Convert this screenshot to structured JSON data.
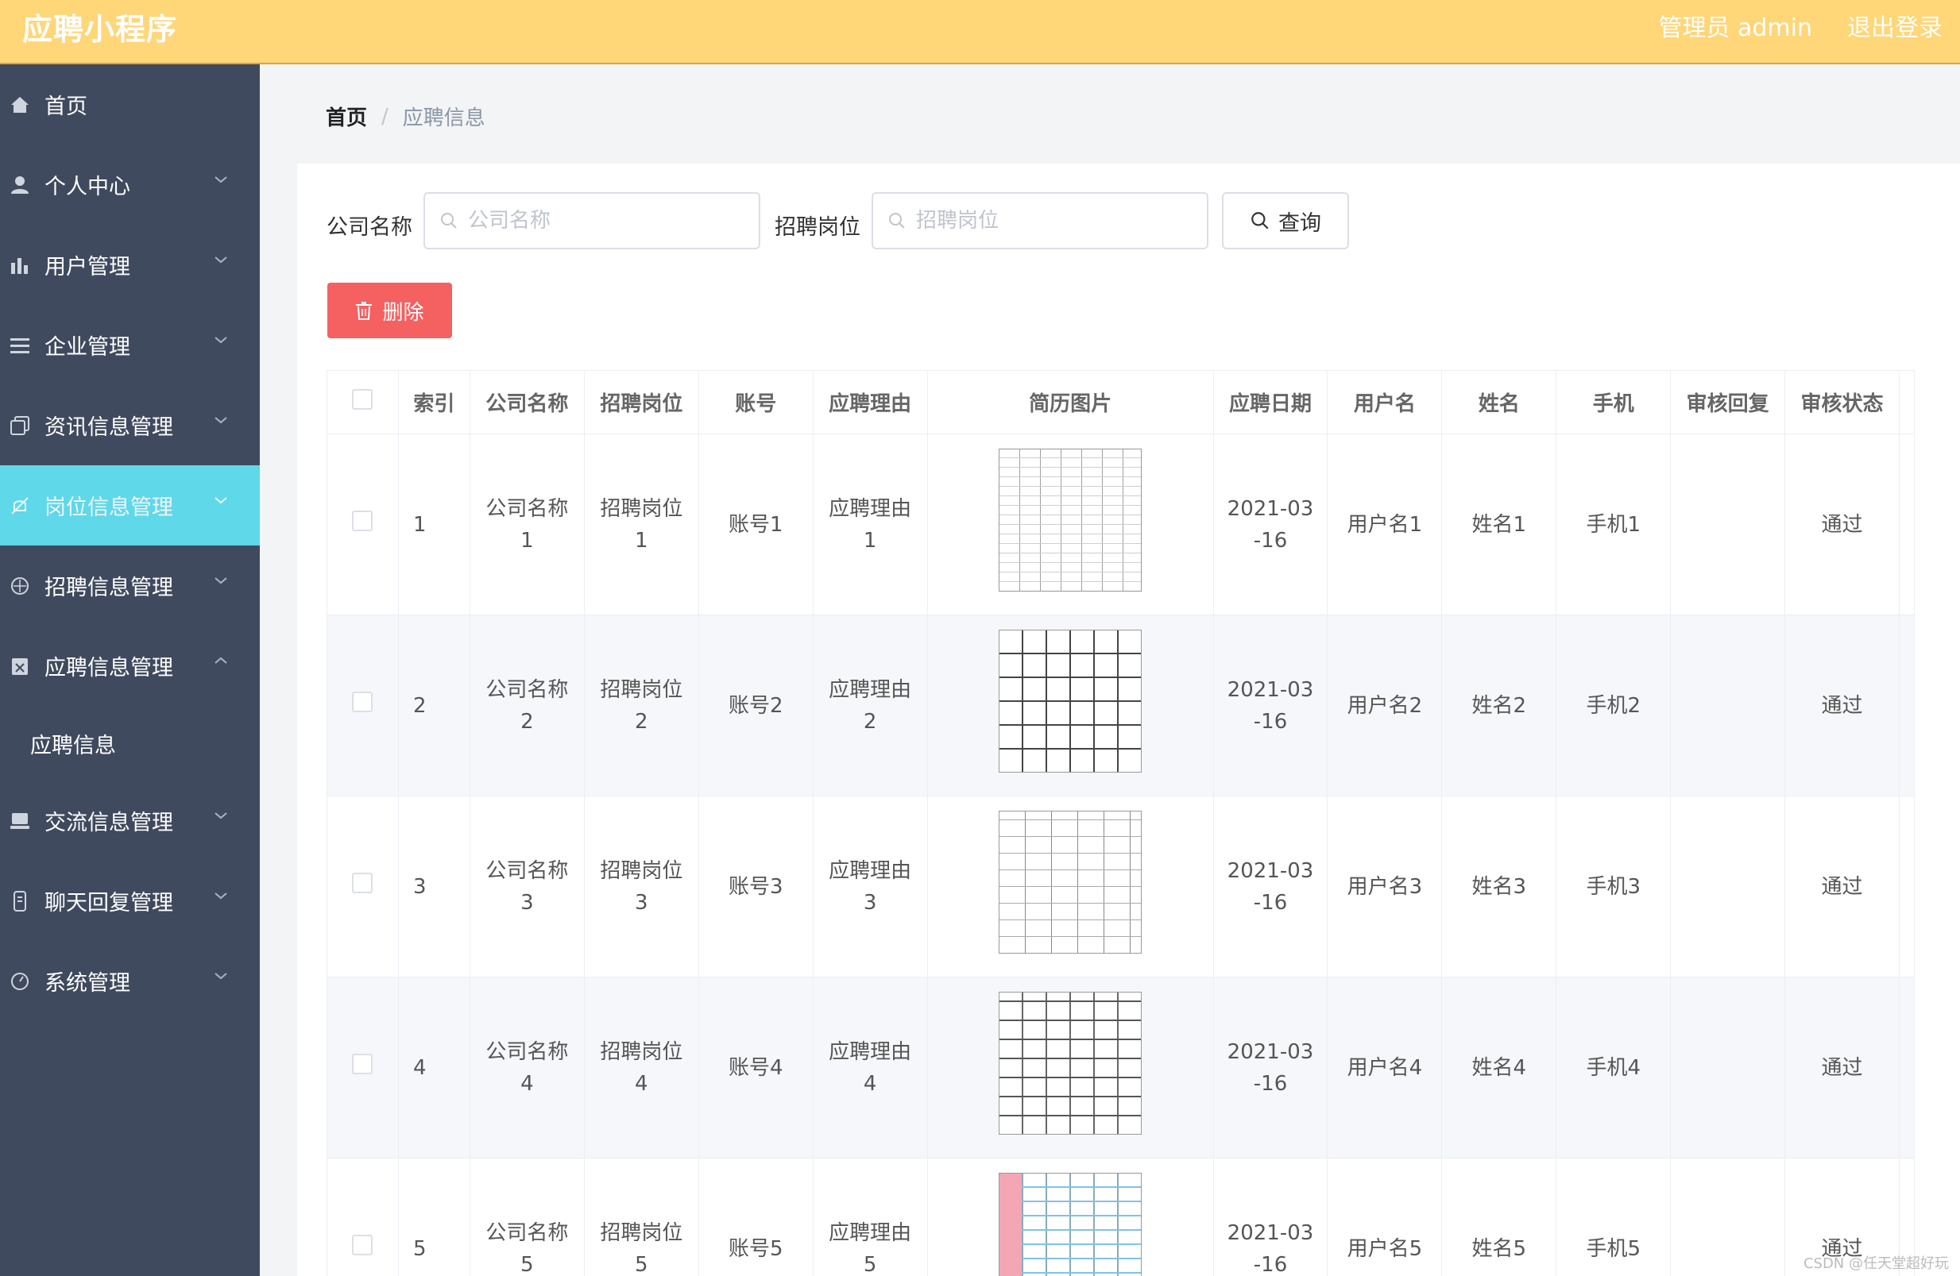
{
  "header": {
    "logo": "应聘小程序",
    "admin_label": "管理员 admin",
    "logout_label": "退出登录"
  },
  "sidebar": {
    "items": [
      {
        "label": "首页"
      },
      {
        "label": "个人中心"
      },
      {
        "label": "用户管理"
      },
      {
        "label": "企业管理"
      },
      {
        "label": "资讯信息管理"
      },
      {
        "label": "岗位信息管理"
      },
      {
        "label": "招聘信息管理"
      },
      {
        "label": "应聘信息管理"
      }
    ],
    "sub_item": "应聘信息",
    "items_after": [
      {
        "label": "交流信息管理"
      },
      {
        "label": "聊天回复管理"
      },
      {
        "label": "系统管理"
      }
    ]
  },
  "breadcrumb": {
    "home": "首页",
    "separator": "/",
    "current": "应聘信息"
  },
  "filters": {
    "company_label": "公司名称",
    "company_placeholder": "公司名称",
    "position_label": "招聘岗位",
    "position_placeholder": "招聘岗位",
    "query_label": "查询"
  },
  "actions": {
    "delete_label": "删除"
  },
  "table": {
    "headers": [
      "索引",
      "公司名称",
      "招聘岗位",
      "账号",
      "应聘理由",
      "简历图片",
      "应聘日期",
      "用户名",
      "姓名",
      "手机",
      "审核回复",
      "审核状态"
    ],
    "rows": [
      {
        "index": "1",
        "company": "公司名称1",
        "position": "招聘岗位1",
        "account": "账号1",
        "reason": "应聘理由1",
        "date": "2021-03-16",
        "username": "用户名1",
        "name": "姓名1",
        "phone": "手机1",
        "reply": "",
        "status": "通过"
      },
      {
        "index": "2",
        "company": "公司名称2",
        "position": "招聘岗位2",
        "account": "账号2",
        "reason": "应聘理由2",
        "date": "2021-03-16",
        "username": "用户名2",
        "name": "姓名2",
        "phone": "手机2",
        "reply": "",
        "status": "通过"
      },
      {
        "index": "3",
        "company": "公司名称3",
        "position": "招聘岗位3",
        "account": "账号3",
        "reason": "应聘理由3",
        "date": "2021-03-16",
        "username": "用户名3",
        "name": "姓名3",
        "phone": "手机3",
        "reply": "",
        "status": "通过"
      },
      {
        "index": "4",
        "company": "公司名称4",
        "position": "招聘岗位4",
        "account": "账号4",
        "reason": "应聘理由4",
        "date": "2021-03-16",
        "username": "用户名4",
        "name": "姓名4",
        "phone": "手机4",
        "reply": "",
        "status": "通过"
      },
      {
        "index": "5",
        "company": "公司名称5",
        "position": "招聘岗位5",
        "account": "账号5",
        "reason": "应聘理由5",
        "date": "2021-03-16",
        "username": "用户名5",
        "name": "姓名5",
        "phone": "手机5",
        "reply": "",
        "status": "通过"
      }
    ]
  },
  "watermark": "CSDN @任天堂超好玩",
  "colors": {
    "header": "#ffd678",
    "sidebar": "#404a5e",
    "active": "#5fd8ea",
    "danger": "#f56060"
  }
}
